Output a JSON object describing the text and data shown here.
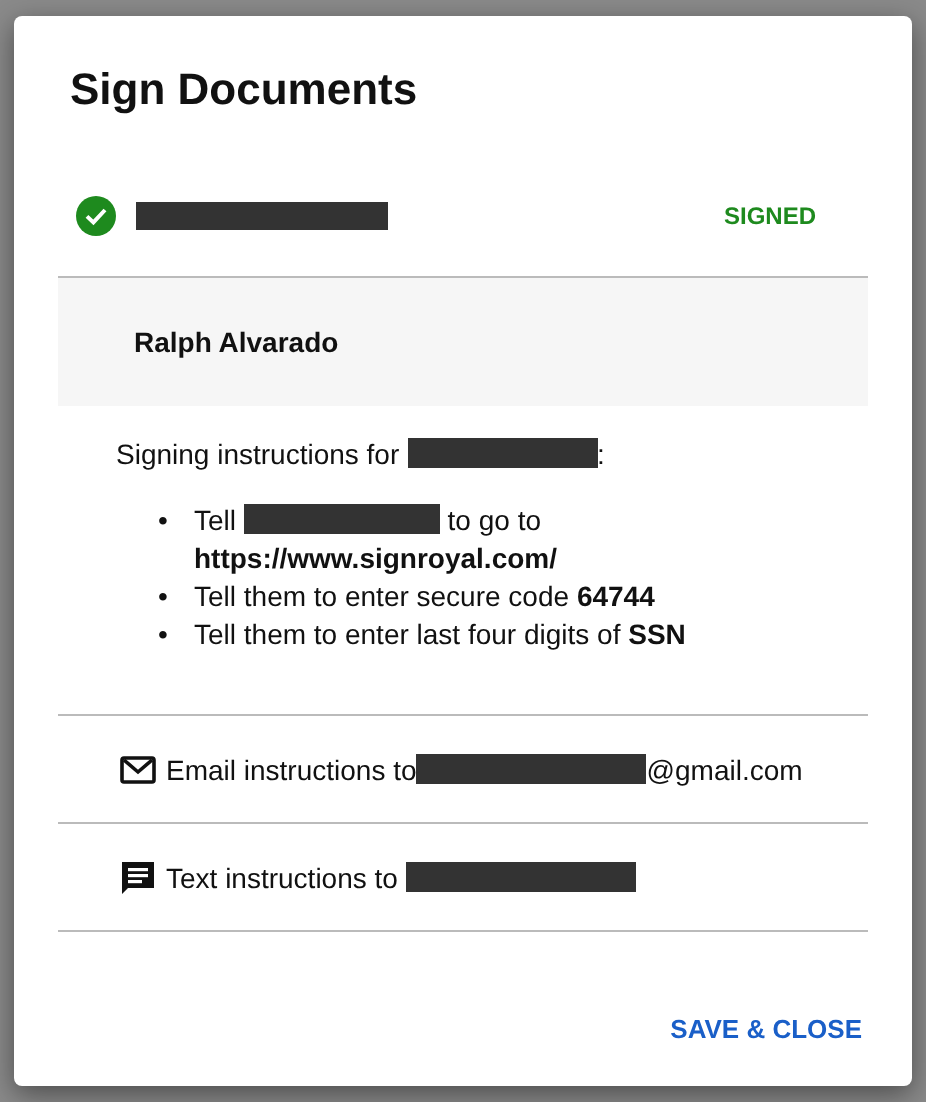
{
  "dialog": {
    "title": "Sign Documents",
    "document": {
      "status_label": "SIGNED"
    },
    "signer": {
      "name": "Ralph Alvarado"
    },
    "instructions": {
      "heading": [
        {
          "kind": "text",
          "text": "Signing instructions for "
        },
        {
          "kind": "redacted"
        },
        {
          "kind": "text",
          "text": ":"
        }
      ],
      "items": [
        {
          "bullet": "•",
          "parts": [
            {
              "kind": "text",
              "text": "Tell "
            },
            {
              "kind": "redacted"
            },
            {
              "kind": "text",
              "text": " to go to **https://www.signroyal.com/**"
            }
          ]
        },
        {
          "bullet": "•",
          "parts": [
            {
              "kind": "text",
              "text": "Tell them to enter secure code **64744**"
            }
          ]
        },
        {
          "bullet": "•",
          "parts": [
            {
              "kind": "text",
              "text": "Tell them to enter last four digits of **SSN**"
            }
          ]
        }
      ]
    },
    "send_options": [
      {
        "kind": "email",
        "parts": [
          {
            "kind": "text",
            "text": "Email instructions to"
          },
          {
            "kind": "redacted"
          },
          {
            "kind": "text",
            "text": "@gmail.com"
          }
        ]
      },
      {
        "kind": "sms",
        "parts": [
          {
            "kind": "text",
            "text": "Text instructions to "
          },
          {
            "kind": "redacted"
          }
        ]
      }
    ],
    "buttons": [
      "SAVE & CLOSE"
    ]
  }
}
